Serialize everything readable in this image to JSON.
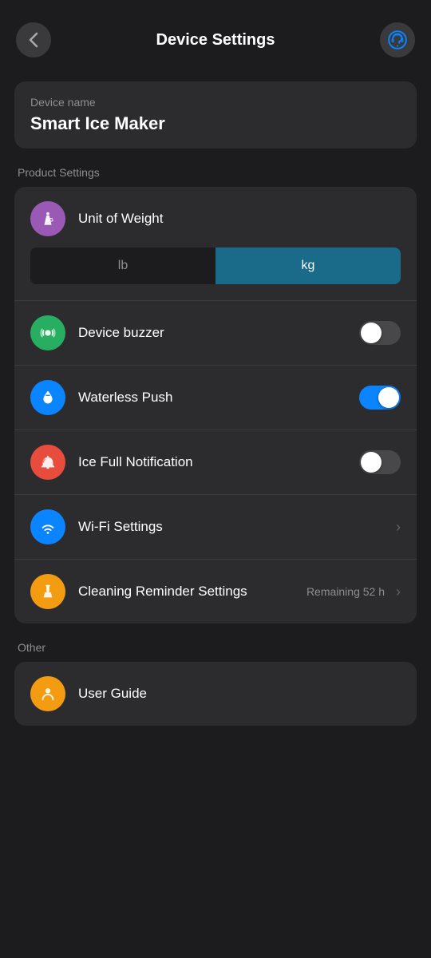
{
  "header": {
    "title": "Device Settings",
    "back_icon": "‹",
    "support_icon": "🎧"
  },
  "device": {
    "label": "Device name",
    "name": "Smart Ice Maker"
  },
  "sections": {
    "product": {
      "label": "Product Settings",
      "items": [
        {
          "id": "unit-of-weight",
          "label": "Unit of Weight",
          "icon_bg": "#9b59b6",
          "icon": "⚖",
          "type": "weight-toggle",
          "options": [
            "lb",
            "kg"
          ],
          "active_option": 1
        },
        {
          "id": "device-buzzer",
          "label": "Device buzzer",
          "icon_bg": "#27ae60",
          "icon": "🔊",
          "type": "toggle",
          "value": false
        },
        {
          "id": "waterless-push",
          "label": "Waterless Push",
          "icon_bg": "#0a84ff",
          "icon": "💧",
          "type": "toggle",
          "value": true
        },
        {
          "id": "ice-full-notification",
          "label": "Ice Full Notification",
          "icon_bg": "#e74c3c",
          "icon": "🔔",
          "type": "toggle",
          "value": false
        },
        {
          "id": "wifi-settings",
          "label": "Wi-Fi Settings",
          "icon_bg": "#0a84ff",
          "icon": "wifi",
          "type": "nav"
        },
        {
          "id": "cleaning-reminder",
          "label": "Cleaning Reminder Settings",
          "icon_bg": "#f39c12",
          "icon": "🧹",
          "type": "nav",
          "extra": "Remaining 52 h"
        }
      ]
    },
    "other": {
      "label": "Other",
      "items": [
        {
          "id": "user-guide",
          "label": "User Guide",
          "icon_bg": "#f39c12",
          "icon": "👤",
          "type": "nav"
        }
      ]
    }
  }
}
